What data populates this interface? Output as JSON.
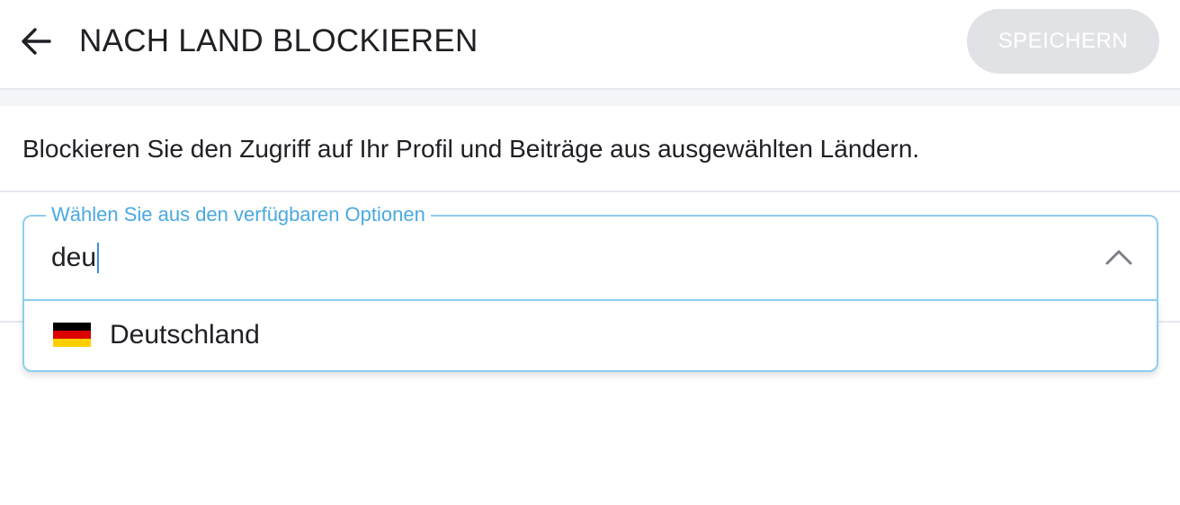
{
  "header": {
    "title": "NACH LAND BLOCKIEREN",
    "save_label": "SPEICHERN",
    "back_icon": "arrow-left-icon"
  },
  "description": "Blockieren Sie den Zugriff auf Ihr Profil und Beiträge aus ausgewählten Ländern.",
  "country_select": {
    "label": "Wählen Sie aus den verfügbaren Optionen",
    "value": "deu",
    "toggle_icon": "chevron-up-icon",
    "options": [
      {
        "label": "Deutschland",
        "flag_icon": "germany-flag-icon",
        "flag_colors": [
          "#000000",
          "#dd0000",
          "#ffce00"
        ]
      }
    ]
  },
  "colors": {
    "accent": "#4aa9df",
    "field_border": "#8ecdef",
    "save_disabled_bg": "#e1e2e6"
  }
}
